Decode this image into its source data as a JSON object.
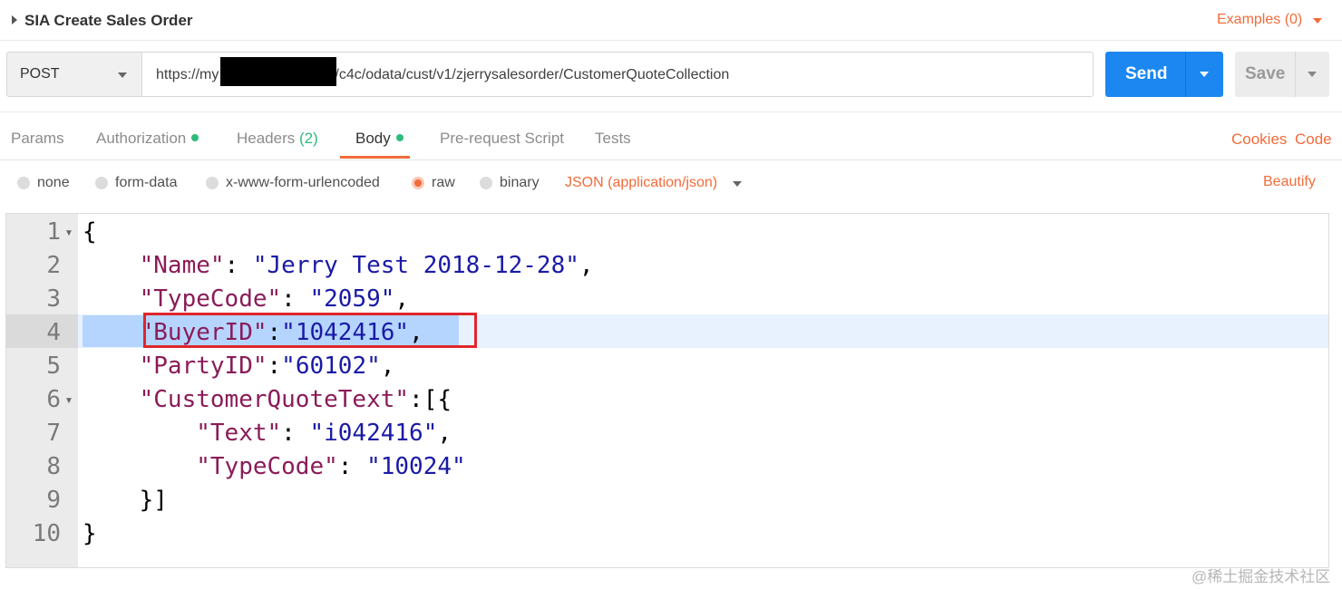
{
  "request": {
    "title": "SIA Create Sales Order",
    "examples_label": "Examples (0)",
    "method": "POST",
    "url": "https://my                     ybriscloud.cn/sap/c4c/odata/cust/v1/zjerrysalesorder/CustomerQuoteCollection",
    "send_label": "Send",
    "save_label": "Save"
  },
  "tabs": {
    "params": "Params",
    "authorization": "Authorization",
    "headers": "Headers",
    "headers_count": "(2)",
    "body": "Body",
    "prerequest": "Pre-request Script",
    "tests": "Tests",
    "active": "Body",
    "cookies": "Cookies",
    "code": "Code"
  },
  "body_options": {
    "none": "none",
    "form_data": "form-data",
    "urlencoded": "x-www-form-urlencoded",
    "raw": "raw",
    "binary": "binary",
    "selected": "raw",
    "content_type": "JSON (application/json)",
    "beautify": "Beautify"
  },
  "editor": {
    "highlighted_line": 4,
    "lines": [
      {
        "no": "1",
        "key": "",
        "sep": "",
        "val": "",
        "pre": "{",
        "post": ""
      },
      {
        "no": "2",
        "pre": "    ",
        "key": "\"Name\"",
        "sep": ": ",
        "val": "\"Jerry Test 2018-12-28\"",
        "post": ","
      },
      {
        "no": "3",
        "pre": "    ",
        "key": "\"TypeCode\"",
        "sep": ": ",
        "val": "\"2059\"",
        "post": ","
      },
      {
        "no": "4",
        "pre": "    ",
        "key": "\"BuyerID\"",
        "sep": ":",
        "val": "\"1042416\"",
        "post": ","
      },
      {
        "no": "5",
        "pre": "    ",
        "key": "\"PartyID\"",
        "sep": ":",
        "val": "\"60102\"",
        "post": ","
      },
      {
        "no": "6",
        "pre": "    ",
        "key": "\"CustomerQuoteText\"",
        "sep": ":[{",
        "val": "",
        "post": ""
      },
      {
        "no": "7",
        "pre": "        ",
        "key": "\"Text\"",
        "sep": ": ",
        "val": "\"i042416\"",
        "post": ","
      },
      {
        "no": "8",
        "pre": "        ",
        "key": "\"TypeCode\"",
        "sep": ": ",
        "val": "\"10024\"",
        "post": ""
      },
      {
        "no": "9",
        "pre": "    }]",
        "key": "",
        "sep": "",
        "val": "",
        "post": ""
      },
      {
        "no": "10",
        "pre": "}",
        "key": "",
        "sep": "",
        "val": "",
        "post": ""
      }
    ]
  },
  "watermark": "@稀土掘金技术社区",
  "colors": {
    "accent": "#f26b3a",
    "send": "#1c87f0",
    "status_dot": "#2ebb7b",
    "json_key": "#8a1c58",
    "json_string": "#1a1aa6",
    "annotation_box": "#e0262a"
  }
}
